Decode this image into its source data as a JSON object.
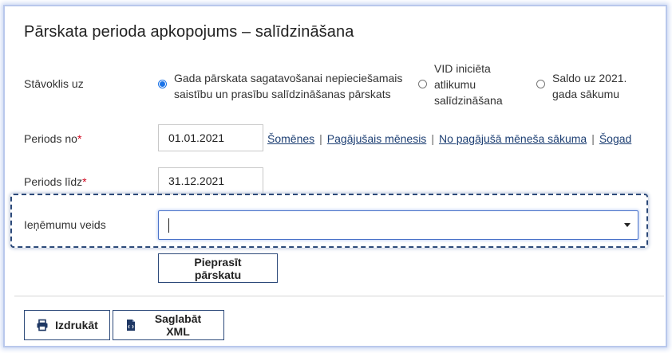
{
  "title": "Pārskata perioda apkopojums – salīdzināšana",
  "status": {
    "label": "Stāvoklis uz",
    "options": [
      {
        "line1": "Gada pārskata sagatavošanai nepieciešamais",
        "line2": "saistību un prasību salīdzināšanas pārskats",
        "line3": "",
        "checked": true
      },
      {
        "line1": "VID iniciēta",
        "line2": "atlikumu",
        "line3": "salīdzināšana",
        "checked": false
      },
      {
        "line1": "Saldo uz 2021.",
        "line2": "gada sākumu",
        "line3": "",
        "checked": false
      }
    ]
  },
  "period_from": {
    "label": "Periods no",
    "required_mark": "*",
    "value": "01.01.2021"
  },
  "period_to": {
    "label": "Periods līdz",
    "required_mark": "*",
    "value": "31.12.2021"
  },
  "quick_links": [
    "Šomēnes",
    "Pagājušais mēnesis",
    "No pagājušā mēneša sākuma",
    "Šogad"
  ],
  "link_separator": "|",
  "revenue_type": {
    "label": "Ieņēmumu veids",
    "value": ""
  },
  "request_button": "Pieprasīt pārskatu",
  "footer": {
    "print_button": "Izdrukāt",
    "save_xml_button": "Saglabāt XML"
  },
  "colors": {
    "accent": "#1a73e8",
    "link": "#1d3f73",
    "required": "#d0021b",
    "button_border": "#2d4a7a"
  },
  "icons": {
    "print": "printer-icon",
    "xml": "xml-file-icon",
    "dropdown": "chevron-down-icon"
  }
}
